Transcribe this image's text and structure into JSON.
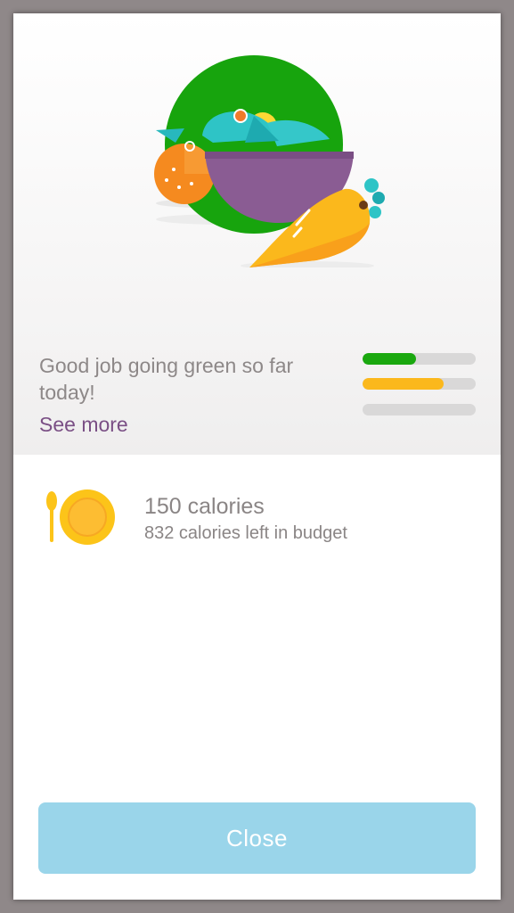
{
  "hero": {
    "illustration_icon": "salad-bowl-illustration",
    "message": "Good job going green so far today!",
    "see_more_label": "See more",
    "progress_bars": [
      {
        "name": "green",
        "fraction": 0.47,
        "color": "#1aa80f"
      },
      {
        "name": "yellow",
        "fraction": 0.72,
        "color": "#fbb81c"
      },
      {
        "name": "red",
        "fraction": 0.0,
        "color": "#e53935"
      }
    ]
  },
  "meal": {
    "icon": "plate-spoon-icon",
    "calories": "150 calories",
    "budget": "832 calories left in budget"
  },
  "footer": {
    "close_label": "Close"
  },
  "colors": {
    "accent_purple": "#7a4f85",
    "button_blue": "#9ad5ea",
    "text_gray": "#8d8888",
    "background_dim": "#8f8889"
  }
}
